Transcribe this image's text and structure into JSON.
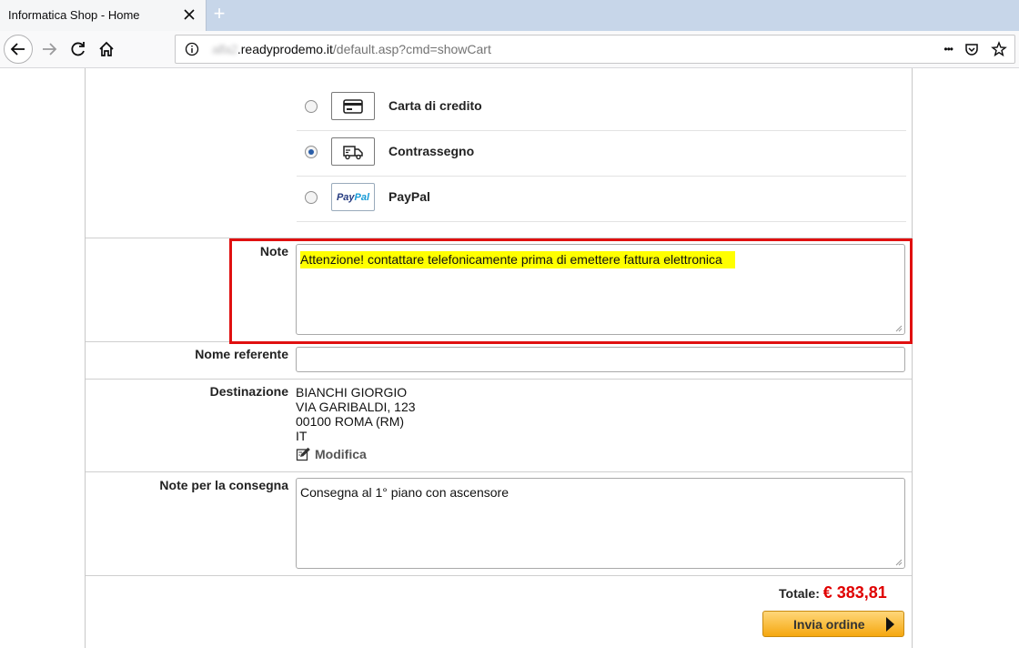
{
  "browser": {
    "tab_title": "Informatica Shop - Home",
    "new_tab": "+",
    "url": {
      "blurred": "alfa2",
      "host": ".readyprodemo.it",
      "path": "/default.asp?cmd=showCart"
    },
    "menu_dots": "•••"
  },
  "payment": {
    "options": [
      {
        "label": "Carta di credito",
        "icon": "credit-card-icon",
        "selected": false
      },
      {
        "label": "Contrassegno",
        "icon": "delivery-truck-icon",
        "selected": true
      },
      {
        "label": "PayPal",
        "icon": "paypal-logo",
        "selected": false
      }
    ],
    "paypal_logo": {
      "part1": "Pay",
      "part2": "Pal"
    }
  },
  "form": {
    "note_label": "Note",
    "note_value": "Attenzione! contattare telefonicamente prima di emettere fattura elettronica",
    "referente_label": "Nome referente",
    "referente_value": "",
    "destinazione_label": "Destinazione",
    "destinazione_lines": [
      "BIANCHI GIORGIO",
      "VIA GARIBALDI, 123",
      "00100 ROMA (RM)",
      "IT"
    ],
    "modifica_label": "Modifica",
    "consegna_label": "Note per la consegna",
    "consegna_value": "Consegna al 1° piano con ascensore"
  },
  "summary": {
    "total_label": "Totale:",
    "total_value": "€ 383,81",
    "order_button": "Invia ordine"
  },
  "colors": {
    "highlight": "#ffff00",
    "annotation_box": "#e01010",
    "total_amount": "#e00000",
    "order_button": "#f5a70f"
  }
}
